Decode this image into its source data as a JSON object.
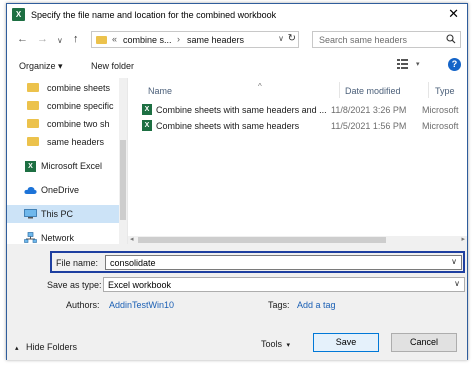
{
  "title": "Specify the file name and location for the combined workbook",
  "title_icon": "X",
  "nav": {
    "back_label": "←",
    "forward_label": "→",
    "recent_label": "∨",
    "up_label": "↑",
    "breadcrumb_overflow": "«",
    "breadcrumb": [
      "combine s...",
      "same headers"
    ],
    "breadcrumb_sep": "›",
    "search_placeholder": "Search same headers"
  },
  "toolbar": {
    "organize": "Organize ▾",
    "new_folder": "New folder",
    "help": "?"
  },
  "sidebar": {
    "items": [
      {
        "label": "combine sheets",
        "icon": "folder-icon"
      },
      {
        "label": "combine specific",
        "icon": "folder-icon"
      },
      {
        "label": "combine two sh",
        "icon": "folder-icon"
      },
      {
        "label": "same headers",
        "icon": "folder-icon"
      },
      {
        "label": "Microsoft Excel",
        "icon": "excel-icon"
      },
      {
        "label": "OneDrive",
        "icon": "cloud-icon"
      },
      {
        "label": "This PC",
        "icon": "pc-icon"
      },
      {
        "label": "Network",
        "icon": "network-icon"
      }
    ]
  },
  "files": {
    "columns": [
      "Name",
      "Date modified",
      "Type"
    ],
    "rows": [
      {
        "name": "Combine sheets with same headers and ...",
        "date": "11/8/2021 3:26 PM",
        "type": "Microsoft"
      },
      {
        "name": "Combine sheets with same headers",
        "date": "11/5/2021 1:56 PM",
        "type": "Microsoft"
      }
    ]
  },
  "form": {
    "file_name_label": "File name:",
    "file_name_value": "consolidate",
    "save_type_label": "Save as type:",
    "save_type_value": "Excel workbook",
    "authors_label": "Authors:",
    "authors_value": "AddinTestWin10",
    "tags_label": "Tags:",
    "tags_value": "Add a tag"
  },
  "buttons": {
    "tools": "Tools",
    "save": "Save",
    "cancel": "Cancel",
    "hide_folders": "Hide Folders"
  },
  "colors": {
    "accent": "#0078d7",
    "focus_border": "#1e3fa0",
    "folder": "#ecc24c",
    "excel": "#1d6f42"
  }
}
